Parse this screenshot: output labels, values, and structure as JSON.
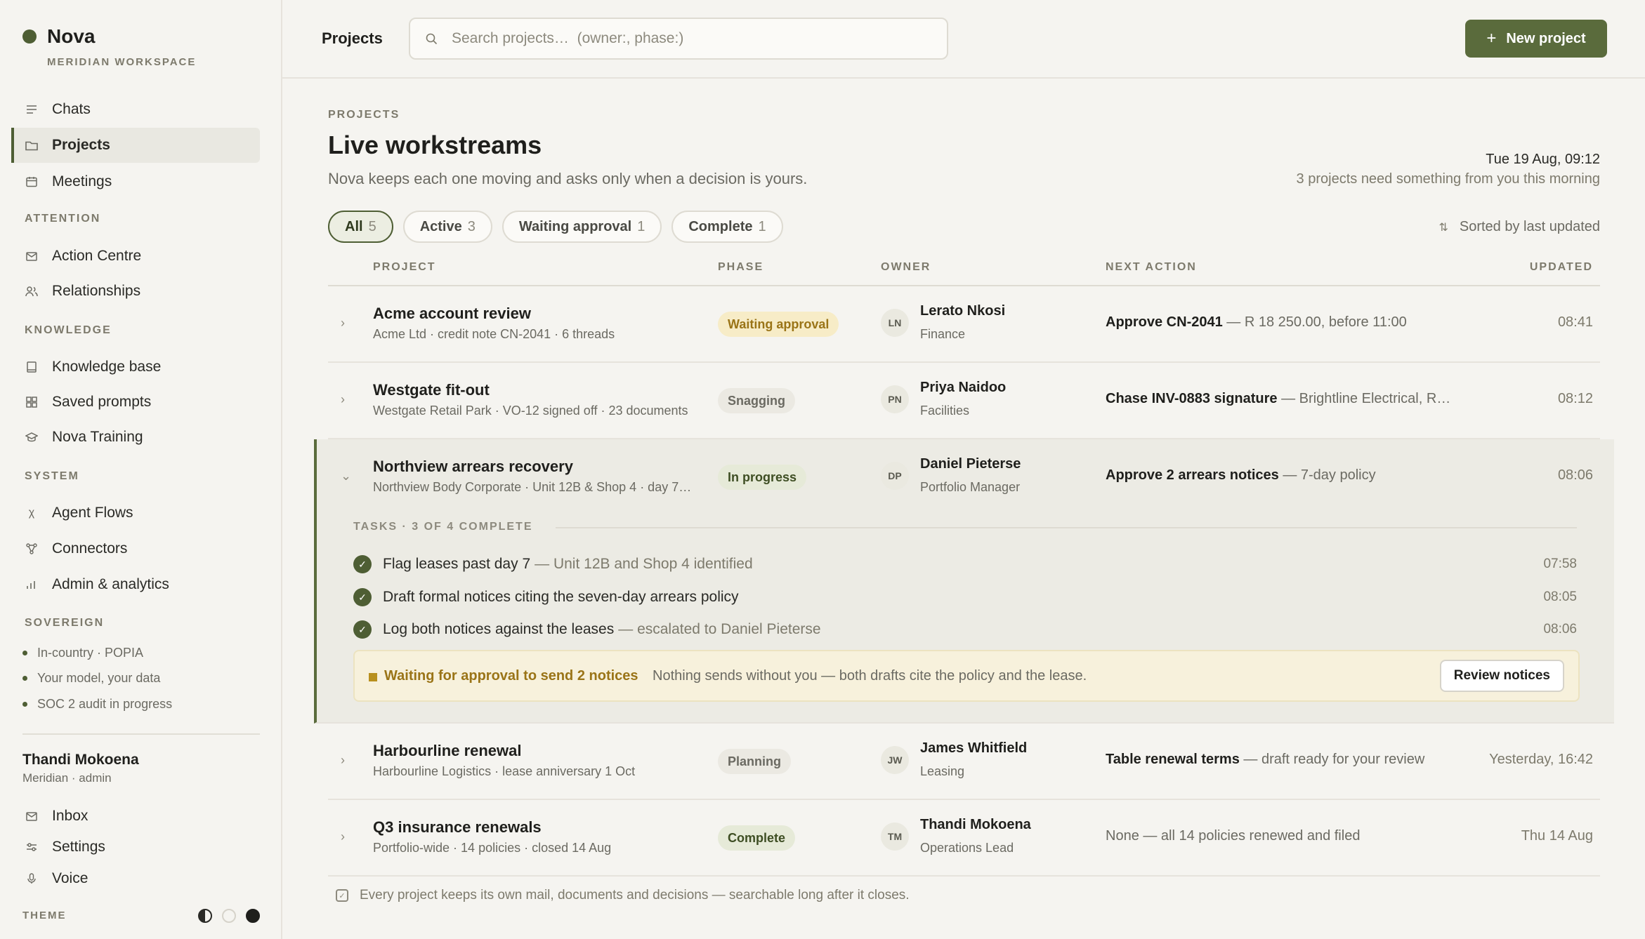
{
  "sidebar": {
    "brand": "Nova",
    "workspace": "MERIDIAN WORKSPACE",
    "nav": [
      {
        "label": "Chats",
        "icon": "chats-icon"
      },
      {
        "label": "Projects",
        "icon": "folder-icon"
      },
      {
        "label": "Meetings",
        "icon": "calendar-icon"
      }
    ],
    "sections": {
      "attention": "ATTENTION",
      "knowledge": "KNOWLEDGE",
      "system": "SYSTEM",
      "sovereign": "SOVEREIGN"
    },
    "attention_items": [
      {
        "label": "Action Centre",
        "icon": "mail-icon"
      },
      {
        "label": "Relationships",
        "icon": "people-icon"
      }
    ],
    "knowledge_items": [
      {
        "label": "Knowledge base",
        "icon": "book-icon"
      },
      {
        "label": "Saved prompts",
        "icon": "grid-icon"
      },
      {
        "label": "Nova Training",
        "icon": "graduation-cap-icon"
      }
    ],
    "system_items": [
      {
        "label": "Agent Flows",
        "icon": "flow-icon"
      },
      {
        "label": "Connectors",
        "icon": "connector-icon"
      },
      {
        "label": "Admin & analytics",
        "icon": "bar-chart-icon"
      }
    ],
    "sovereign_items": [
      "In-country · POPIA",
      "Your model, your data",
      "SOC 2 audit in progress"
    ],
    "user": {
      "name": "Thandi Mokoena",
      "role": "Meridian · admin"
    },
    "bottom_items": [
      {
        "label": "Inbox",
        "icon": "mail-icon"
      },
      {
        "label": "Settings",
        "icon": "sliders-icon"
      },
      {
        "label": "Voice",
        "icon": "microphone-icon"
      }
    ],
    "theme_label": "THEME"
  },
  "topbar": {
    "title": "Projects",
    "search_placeholder": "Search projects…  (owner:, phase:)",
    "new_button": "New project"
  },
  "main": {
    "eyebrow": "PROJECTS",
    "title": "Live workstreams",
    "subtitle": "Nova keeps each one moving and asks only when a decision is yours.",
    "date": "Tue 19 Aug, 09:12",
    "date_note": "3 projects need something from you this morning",
    "filters": [
      {
        "label": "All",
        "count": "5"
      },
      {
        "label": "Active",
        "count": "3"
      },
      {
        "label": "Waiting approval",
        "count": "1"
      },
      {
        "label": "Complete",
        "count": "1"
      }
    ],
    "sort_label": "Sorted by last updated",
    "columns": {
      "project": "PROJECT",
      "phase": "PHASE",
      "owner": "OWNER",
      "next_action": "NEXT ACTION",
      "updated": "UPDATED"
    },
    "rows": [
      {
        "name": "Acme account review",
        "meta": "Acme Ltd · credit note CN-2041 · 6 threads",
        "phase": "Waiting approval",
        "initials": "LN",
        "owner": "Lerato Nkosi",
        "role": "Finance",
        "action_bold": "Approve CN-2041",
        "action_rest": " — R 18 250.00, before 11:00",
        "updated": "08:41"
      },
      {
        "name": "Westgate fit-out",
        "meta": "Westgate Retail Park · VO-12 signed off · 23 documents",
        "phase": "Snagging",
        "initials": "PN",
        "owner": "Priya Naidoo",
        "role": "Facilities",
        "action_bold": "Chase INV-0883 signature",
        "action_rest": " — Brightline Electrical, R…",
        "updated": "08:12"
      },
      {
        "name": "Northview arrears recovery",
        "meta": "Northview Body Corporate · Unit 12B & Shop 4 · day 7…",
        "phase": "In progress",
        "initials": "DP",
        "owner": "Daniel Pieterse",
        "role": "Portfolio Manager",
        "action_bold": "Approve 2 arrears notices",
        "action_rest": " — 7-day policy",
        "updated": "08:06"
      },
      {
        "name": "Harbourline renewal",
        "meta": "Harbourline Logistics · lease anniversary 1 Oct",
        "phase": "Planning",
        "initials": "JW",
        "owner": "James Whitfield",
        "role": "Leasing",
        "action_bold": "Table renewal terms",
        "action_rest": " — draft ready for your review",
        "updated": "Yesterday, 16:42"
      },
      {
        "name": "Q3 insurance renewals",
        "meta": "Portfolio-wide · 14 policies · closed 14 Aug",
        "phase": "Complete",
        "initials": "TM",
        "owner": "Thandi Mokoena",
        "role": "Operations Lead",
        "action_bold": "",
        "action_rest": "None — all 14 policies renewed and filed",
        "updated": "Thu 14 Aug"
      }
    ],
    "tasks": {
      "label": "TASKS · 3 OF 4 COMPLETE",
      "items": [
        {
          "text": "Flag leases past day 7",
          "muted": "— Unit 12B and Shop 4 identified",
          "time": "07:58"
        },
        {
          "text": "Draft formal notices citing the seven-day arrears policy",
          "muted": "",
          "time": "08:05"
        },
        {
          "text": "Log both notices against the leases",
          "muted": "— escalated to Daniel Pieterse",
          "time": "08:06"
        }
      ],
      "approval_title": "Waiting for approval to send 2 notices",
      "approval_text": "Nothing sends without you — both drafts cite the policy and the lease.",
      "review_button": "Review notices"
    },
    "footer_note": "Every project keeps its own mail, documents and decisions — searchable long after it closes."
  }
}
